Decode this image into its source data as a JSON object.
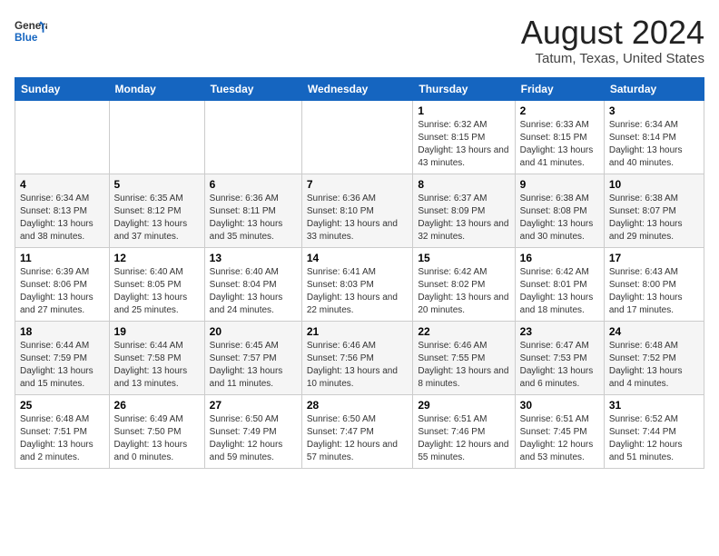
{
  "header": {
    "logo_line1": "General",
    "logo_line2": "Blue",
    "month": "August 2024",
    "location": "Tatum, Texas, United States"
  },
  "days_of_week": [
    "Sunday",
    "Monday",
    "Tuesday",
    "Wednesday",
    "Thursday",
    "Friday",
    "Saturday"
  ],
  "weeks": [
    [
      {
        "day": "",
        "info": ""
      },
      {
        "day": "",
        "info": ""
      },
      {
        "day": "",
        "info": ""
      },
      {
        "day": "",
        "info": ""
      },
      {
        "day": "1",
        "info": "Sunrise: 6:32 AM\nSunset: 8:15 PM\nDaylight: 13 hours\nand 43 minutes."
      },
      {
        "day": "2",
        "info": "Sunrise: 6:33 AM\nSunset: 8:15 PM\nDaylight: 13 hours\nand 41 minutes."
      },
      {
        "day": "3",
        "info": "Sunrise: 6:34 AM\nSunset: 8:14 PM\nDaylight: 13 hours\nand 40 minutes."
      }
    ],
    [
      {
        "day": "4",
        "info": "Sunrise: 6:34 AM\nSunset: 8:13 PM\nDaylight: 13 hours\nand 38 minutes."
      },
      {
        "day": "5",
        "info": "Sunrise: 6:35 AM\nSunset: 8:12 PM\nDaylight: 13 hours\nand 37 minutes."
      },
      {
        "day": "6",
        "info": "Sunrise: 6:36 AM\nSunset: 8:11 PM\nDaylight: 13 hours\nand 35 minutes."
      },
      {
        "day": "7",
        "info": "Sunrise: 6:36 AM\nSunset: 8:10 PM\nDaylight: 13 hours\nand 33 minutes."
      },
      {
        "day": "8",
        "info": "Sunrise: 6:37 AM\nSunset: 8:09 PM\nDaylight: 13 hours\nand 32 minutes."
      },
      {
        "day": "9",
        "info": "Sunrise: 6:38 AM\nSunset: 8:08 PM\nDaylight: 13 hours\nand 30 minutes."
      },
      {
        "day": "10",
        "info": "Sunrise: 6:38 AM\nSunset: 8:07 PM\nDaylight: 13 hours\nand 29 minutes."
      }
    ],
    [
      {
        "day": "11",
        "info": "Sunrise: 6:39 AM\nSunset: 8:06 PM\nDaylight: 13 hours\nand 27 minutes."
      },
      {
        "day": "12",
        "info": "Sunrise: 6:40 AM\nSunset: 8:05 PM\nDaylight: 13 hours\nand 25 minutes."
      },
      {
        "day": "13",
        "info": "Sunrise: 6:40 AM\nSunset: 8:04 PM\nDaylight: 13 hours\nand 24 minutes."
      },
      {
        "day": "14",
        "info": "Sunrise: 6:41 AM\nSunset: 8:03 PM\nDaylight: 13 hours\nand 22 minutes."
      },
      {
        "day": "15",
        "info": "Sunrise: 6:42 AM\nSunset: 8:02 PM\nDaylight: 13 hours\nand 20 minutes."
      },
      {
        "day": "16",
        "info": "Sunrise: 6:42 AM\nSunset: 8:01 PM\nDaylight: 13 hours\nand 18 minutes."
      },
      {
        "day": "17",
        "info": "Sunrise: 6:43 AM\nSunset: 8:00 PM\nDaylight: 13 hours\nand 17 minutes."
      }
    ],
    [
      {
        "day": "18",
        "info": "Sunrise: 6:44 AM\nSunset: 7:59 PM\nDaylight: 13 hours\nand 15 minutes."
      },
      {
        "day": "19",
        "info": "Sunrise: 6:44 AM\nSunset: 7:58 PM\nDaylight: 13 hours\nand 13 minutes."
      },
      {
        "day": "20",
        "info": "Sunrise: 6:45 AM\nSunset: 7:57 PM\nDaylight: 13 hours\nand 11 minutes."
      },
      {
        "day": "21",
        "info": "Sunrise: 6:46 AM\nSunset: 7:56 PM\nDaylight: 13 hours\nand 10 minutes."
      },
      {
        "day": "22",
        "info": "Sunrise: 6:46 AM\nSunset: 7:55 PM\nDaylight: 13 hours\nand 8 minutes."
      },
      {
        "day": "23",
        "info": "Sunrise: 6:47 AM\nSunset: 7:53 PM\nDaylight: 13 hours\nand 6 minutes."
      },
      {
        "day": "24",
        "info": "Sunrise: 6:48 AM\nSunset: 7:52 PM\nDaylight: 13 hours\nand 4 minutes."
      }
    ],
    [
      {
        "day": "25",
        "info": "Sunrise: 6:48 AM\nSunset: 7:51 PM\nDaylight: 13 hours\nand 2 minutes."
      },
      {
        "day": "26",
        "info": "Sunrise: 6:49 AM\nSunset: 7:50 PM\nDaylight: 13 hours\nand 0 minutes."
      },
      {
        "day": "27",
        "info": "Sunrise: 6:50 AM\nSunset: 7:49 PM\nDaylight: 12 hours\nand 59 minutes."
      },
      {
        "day": "28",
        "info": "Sunrise: 6:50 AM\nSunset: 7:47 PM\nDaylight: 12 hours\nand 57 minutes."
      },
      {
        "day": "29",
        "info": "Sunrise: 6:51 AM\nSunset: 7:46 PM\nDaylight: 12 hours\nand 55 minutes."
      },
      {
        "day": "30",
        "info": "Sunrise: 6:51 AM\nSunset: 7:45 PM\nDaylight: 12 hours\nand 53 minutes."
      },
      {
        "day": "31",
        "info": "Sunrise: 6:52 AM\nSunset: 7:44 PM\nDaylight: 12 hours\nand 51 minutes."
      }
    ]
  ]
}
